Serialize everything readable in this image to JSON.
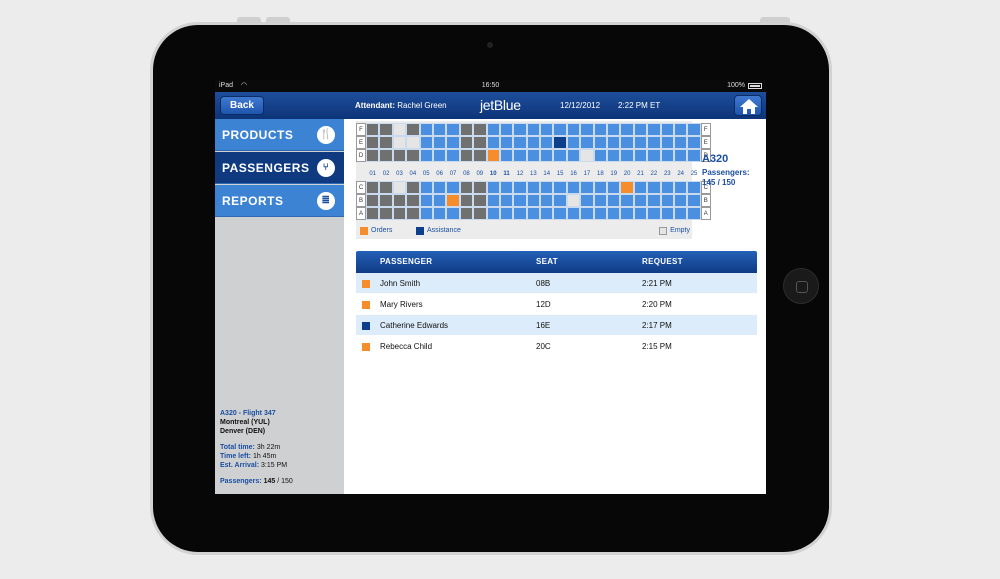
{
  "statusbar": {
    "carrier": "iPad",
    "time": "16:50",
    "battery": "100%"
  },
  "navbar": {
    "back_label": "Back",
    "attendant_label": "Attendant:",
    "attendant_name": "Rachel Green",
    "brand": "jetBlue",
    "date": "12/12/2012",
    "time": "2:22 PM ET",
    "home_icon": "home-icon"
  },
  "sidebar": {
    "items": [
      {
        "label": "PRODUCTS",
        "icon": "utensils-icon"
      },
      {
        "label": "PASSENGERS",
        "icon": "passengers-icon"
      },
      {
        "label": "REPORTS",
        "icon": "report-icon"
      }
    ],
    "active": "PASSENGERS",
    "flight": {
      "line1": "A320  -  Flight 347",
      "from": "Montreal (YUL)",
      "to": "Denver (DEN)",
      "total_time_label": "Total time:",
      "total_time": "3h 22m",
      "time_left_label": "Time left:",
      "time_left": "1h 45m",
      "arrival_label": "Est. Arrival:",
      "arrival": "3:15 PM",
      "passengers_label": "Passengers:",
      "passengers_count": "145",
      "passengers_total": "/ 150"
    }
  },
  "seatmap": {
    "rows_top": [
      "F",
      "E",
      "D"
    ],
    "rows_bottom": [
      "C",
      "B",
      "A"
    ],
    "columns": [
      "01",
      "02",
      "03",
      "04",
      "05",
      "06",
      "07",
      "08",
      "09",
      "10",
      "11",
      "12",
      "13",
      "14",
      "15",
      "16",
      "17",
      "18",
      "19",
      "20",
      "21",
      "22",
      "23",
      "24",
      "25"
    ],
    "bold_columns": [
      "10",
      "11"
    ],
    "seat_grid": {
      "F": [
        "g",
        "g",
        "w",
        "g",
        "b",
        "b",
        "b",
        "g",
        "g",
        "b",
        "b",
        "b",
        "b",
        "b",
        "b",
        "b",
        "b",
        "b",
        "b",
        "b",
        "b",
        "b",
        "b",
        "b",
        "b"
      ],
      "E": [
        "g",
        "g",
        "w",
        "w",
        "b",
        "b",
        "b",
        "g",
        "g",
        "b",
        "b",
        "b",
        "b",
        "b",
        "d",
        "b",
        "b",
        "b",
        "b",
        "b",
        "b",
        "b",
        "b",
        "b",
        "b"
      ],
      "D": [
        "g",
        "g",
        "g",
        "g",
        "b",
        "b",
        "b",
        "g",
        "g",
        "o",
        "b",
        "b",
        "b",
        "b",
        "b",
        "b",
        "w",
        "b",
        "b",
        "b",
        "b",
        "b",
        "b",
        "b",
        "b"
      ],
      "C": [
        "g",
        "g",
        "w",
        "g",
        "b",
        "b",
        "b",
        "g",
        "g",
        "b",
        "b",
        "b",
        "b",
        "b",
        "b",
        "b",
        "b",
        "b",
        "b",
        "o",
        "b",
        "b",
        "b",
        "b",
        "b"
      ],
      "B": [
        "g",
        "g",
        "g",
        "g",
        "b",
        "b",
        "o",
        "g",
        "g",
        "b",
        "b",
        "b",
        "b",
        "b",
        "b",
        "w",
        "b",
        "b",
        "b",
        "b",
        "b",
        "b",
        "b",
        "b",
        "b"
      ],
      "A": [
        "g",
        "g",
        "g",
        "g",
        "b",
        "b",
        "b",
        "g",
        "g",
        "b",
        "b",
        "b",
        "b",
        "b",
        "b",
        "b",
        "b",
        "b",
        "b",
        "b",
        "b",
        "b",
        "b",
        "b",
        "b"
      ]
    },
    "legend": {
      "orders": "Orders",
      "assistance": "Assistance",
      "empty": "Empty"
    },
    "colors": {
      "occupied": "#4a8fe0",
      "blocked": "#707070",
      "empty": "#e5e5e5",
      "orders": "#f58d2c",
      "assistance": "#0e3f8c"
    }
  },
  "aircraft": {
    "model": "A320",
    "passengers_label": "Passengers:",
    "passengers_value": "145 / 150"
  },
  "table": {
    "headers": [
      "PASSENGER",
      "SEAT",
      "REQUEST"
    ],
    "rows": [
      {
        "marker": "orders",
        "name": "John Smith",
        "seat": "08B",
        "time": "2:21 PM"
      },
      {
        "marker": "orders",
        "name": "Mary Rivers",
        "seat": "12D",
        "time": "2:20 PM"
      },
      {
        "marker": "assistance",
        "name": "Catherine Edwards",
        "seat": "16E",
        "time": "2:17 PM"
      },
      {
        "marker": "orders",
        "name": "Rebecca Child",
        "seat": "20C",
        "time": "2:15 PM"
      }
    ]
  }
}
